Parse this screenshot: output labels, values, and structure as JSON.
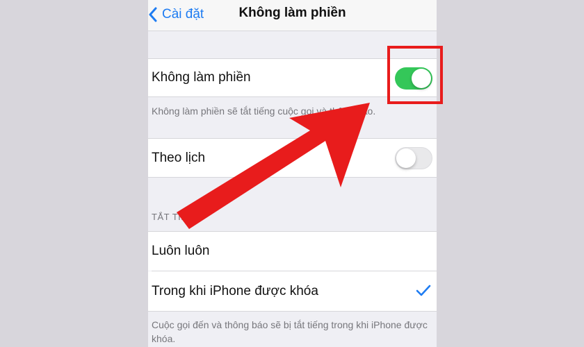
{
  "nav": {
    "back_label": "Cài đặt",
    "title": "Không làm phiền"
  },
  "dnd": {
    "label": "Không làm phiền",
    "enabled": true,
    "footer": "Không làm phiền sẽ tắt tiếng cuộc gọi và thông báo."
  },
  "scheduled": {
    "label": "Theo lịch",
    "enabled": false
  },
  "silence": {
    "header": "TẮT TIẾNG",
    "options": [
      {
        "label": "Luôn luôn",
        "selected": false
      },
      {
        "label": "Trong khi iPhone được khóa",
        "selected": true
      }
    ],
    "footer": "Cuộc gọi đến và thông báo sẽ bị tắt tiếng trong khi iPhone được khóa."
  },
  "colors": {
    "accent": "#1e7cf2",
    "toggle_on": "#34c759",
    "annotation": "#e81c1c"
  },
  "icons": {
    "back": "chevron-left-icon",
    "check": "checkmark-icon"
  }
}
